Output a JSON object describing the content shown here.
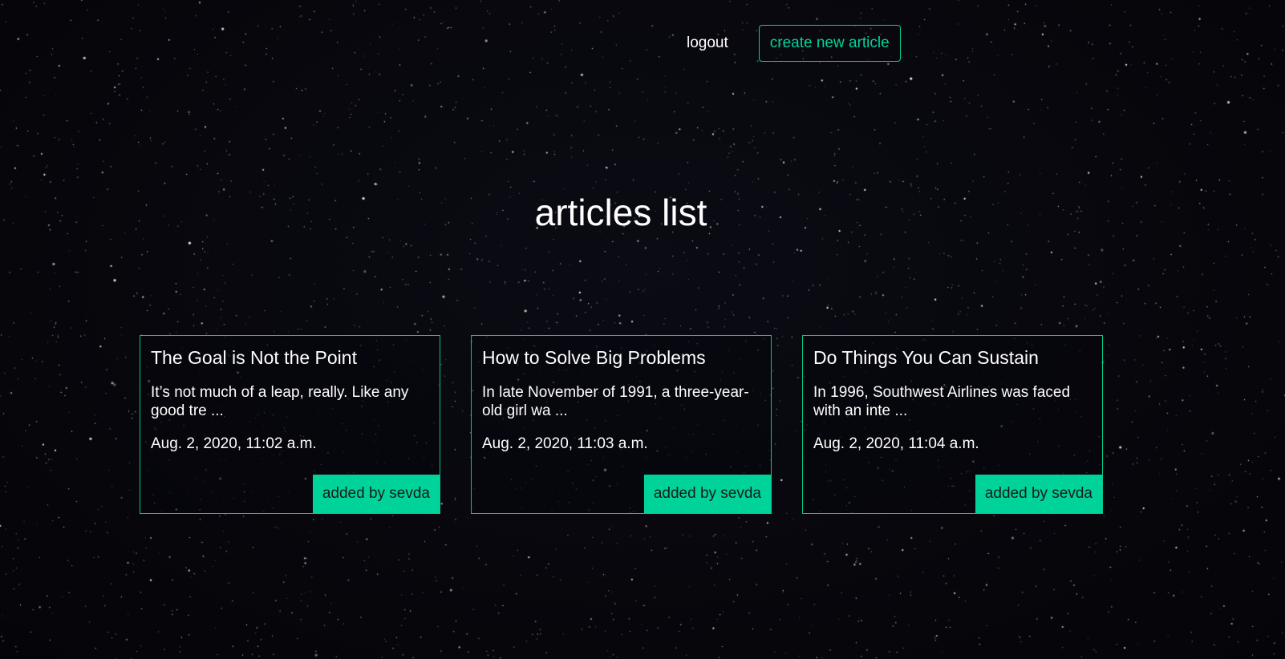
{
  "nav": {
    "logout_label": "logout",
    "create_label": "create new article"
  },
  "page": {
    "title": "articles list"
  },
  "articles": [
    {
      "title": "The Goal is Not the Point",
      "excerpt": "It’s not much of a leap, really. Like any good tre ...",
      "date": "Aug. 2, 2020, 11:02 a.m.",
      "author_label": "added by sevda"
    },
    {
      "title": "How to Solve Big Problems",
      "excerpt": "In late November of 1991, a three-year-old girl wa ...",
      "date": "Aug. 2, 2020, 11:03 a.m.",
      "author_label": "added by sevda"
    },
    {
      "title": "Do Things You Can Sustain",
      "excerpt": "In 1996, Southwest Airlines was faced with an inte ...",
      "date": "Aug. 2, 2020, 11:04 a.m.",
      "author_label": "added by sevda"
    }
  ],
  "colors": {
    "accent": "#00d39a",
    "background": "#07070d",
    "text": "#ffffff"
  }
}
